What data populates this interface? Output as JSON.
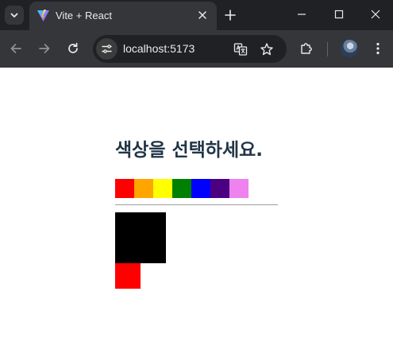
{
  "browser": {
    "tab": {
      "title": "Vite + React"
    },
    "address": {
      "url": "localhost:5173"
    }
  },
  "page": {
    "title": "색상을 선택하세요.",
    "colors": [
      {
        "name": "red",
        "hex": "#ff0000"
      },
      {
        "name": "orange",
        "hex": "#ffa500"
      },
      {
        "name": "yellow",
        "hex": "#ffff00"
      },
      {
        "name": "green",
        "hex": "#008000"
      },
      {
        "name": "blue",
        "hex": "#0000ff"
      },
      {
        "name": "indigo",
        "hex": "#4b0082"
      },
      {
        "name": "violet",
        "hex": "#ee82ee"
      }
    ],
    "selected_large_color": "#000000",
    "selected_small_color": "#ff0000"
  },
  "icons": {
    "tab_search": "chevron-down-icon",
    "favicon": "vite-logo-icon",
    "tab_close": "close-icon",
    "new_tab": "plus-icon",
    "minimize": "minimize-icon",
    "maximize": "maximize-icon",
    "close_window": "close-icon",
    "back": "back-arrow-icon",
    "forward": "forward-arrow-icon",
    "reload": "reload-icon",
    "site_info": "tune-icon",
    "translate": "translate-icon",
    "bookmark": "star-icon",
    "extensions": "puzzle-icon",
    "profile": "avatar",
    "menu": "kebab-menu-icon"
  }
}
